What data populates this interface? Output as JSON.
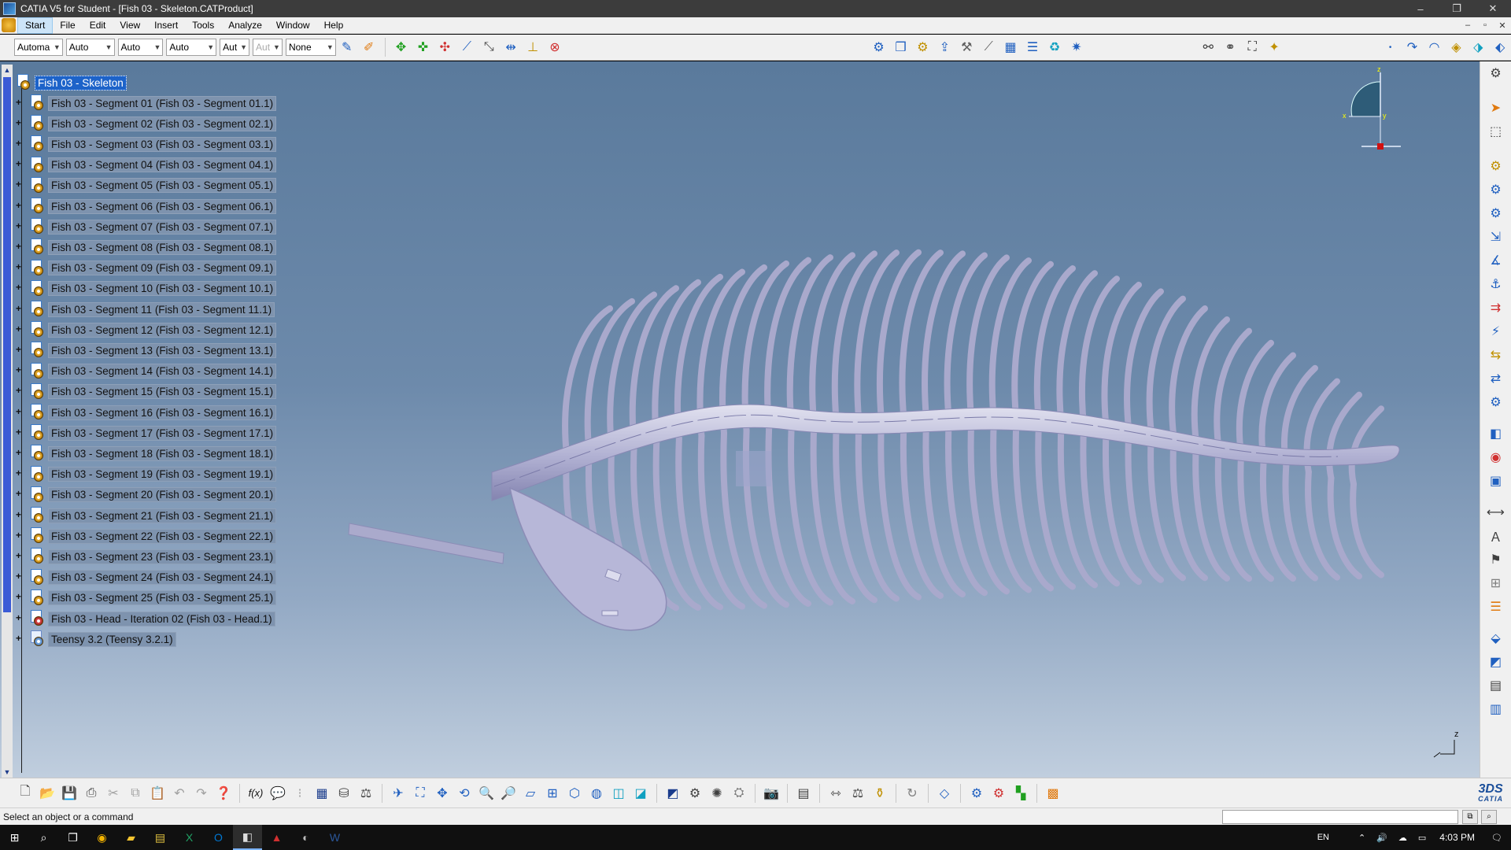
{
  "window": {
    "title": "CATIA V5 for Student - [Fish 03 - Skeleton.CATProduct]",
    "controls": [
      "–",
      "❐",
      "✕"
    ]
  },
  "menubar": {
    "items": [
      "Start",
      "File",
      "Edit",
      "View",
      "Insert",
      "Tools",
      "Analyze",
      "Window",
      "Help"
    ],
    "active": "Start",
    "mdi_controls": [
      "–",
      "▫",
      "✕"
    ]
  },
  "toolbar_top": {
    "combos": [
      {
        "value": "Automa",
        "disabled": false
      },
      {
        "value": "Auto",
        "disabled": false
      },
      {
        "value": "Auto",
        "disabled": false
      },
      {
        "value": "Auto",
        "disabled": false
      },
      {
        "value": "Aut",
        "disabled": false
      },
      {
        "value": "Aut",
        "disabled": true
      },
      {
        "value": "None",
        "disabled": false
      }
    ]
  },
  "tree": {
    "root": "Fish 03 - Skeleton",
    "nodes": [
      "Fish 03 - Segment 01 (Fish 03 - Segment 01.1)",
      "Fish 03 - Segment 02 (Fish 03 - Segment 02.1)",
      "Fish 03 - Segment 03 (Fish 03 - Segment 03.1)",
      "Fish 03 - Segment 04 (Fish 03 - Segment 04.1)",
      "Fish 03 - Segment 05 (Fish 03 - Segment 05.1)",
      "Fish 03 - Segment 06 (Fish 03 - Segment 06.1)",
      "Fish 03 - Segment 07 (Fish 03 - Segment 07.1)",
      "Fish 03 - Segment 08 (Fish 03 - Segment 08.1)",
      "Fish 03 - Segment 09 (Fish 03 - Segment 09.1)",
      "Fish 03 - Segment 10 (Fish 03 - Segment 10.1)",
      "Fish 03 - Segment 11 (Fish 03 - Segment 11.1)",
      "Fish 03 - Segment 12 (Fish 03 - Segment 12.1)",
      "Fish 03 - Segment 13 (Fish 03 - Segment 13.1)",
      "Fish 03 - Segment 14 (Fish 03 - Segment 14.1)",
      "Fish 03 - Segment 15 (Fish 03 - Segment 15.1)",
      "Fish 03 - Segment 16 (Fish 03 - Segment 16.1)",
      "Fish 03 - Segment 17 (Fish 03 - Segment 17.1)",
      "Fish 03 - Segment 18 (Fish 03 - Segment 18.1)",
      "Fish 03 - Segment 19 (Fish 03 - Segment 19.1)",
      "Fish 03 - Segment 20 (Fish 03 - Segment 20.1)",
      "Fish 03 - Segment 21 (Fish 03 - Segment 21.1)",
      "Fish 03 - Segment 22 (Fish 03 - Segment 22.1)",
      "Fish 03 - Segment 23 (Fish 03 - Segment 23.1)",
      "Fish 03 - Segment 24 (Fish 03 - Segment 24.1)",
      "Fish 03 - Segment 25 (Fish 03 - Segment 25.1)",
      "Fish 03 - Head - Iteration 02 (Fish 03 - Head.1)",
      "Teensy 3.2 (Teensy 3.2.1)"
    ]
  },
  "compass": {
    "axis_x": "x",
    "axis_y": "y",
    "axis_z": "z"
  },
  "axis_triad": {
    "label": "z"
  },
  "statusbar": {
    "message": "Select an object or a command",
    "command_value": ""
  },
  "taskbar": {
    "language": "EN",
    "time": "4:03 PM"
  },
  "logo": {
    "brand": "CATIA"
  },
  "colors": {
    "selection": "#1d63c9",
    "viewport_top": "#5a7a9c",
    "viewport_bottom": "#c0cede",
    "model": "#b5b5d6"
  }
}
